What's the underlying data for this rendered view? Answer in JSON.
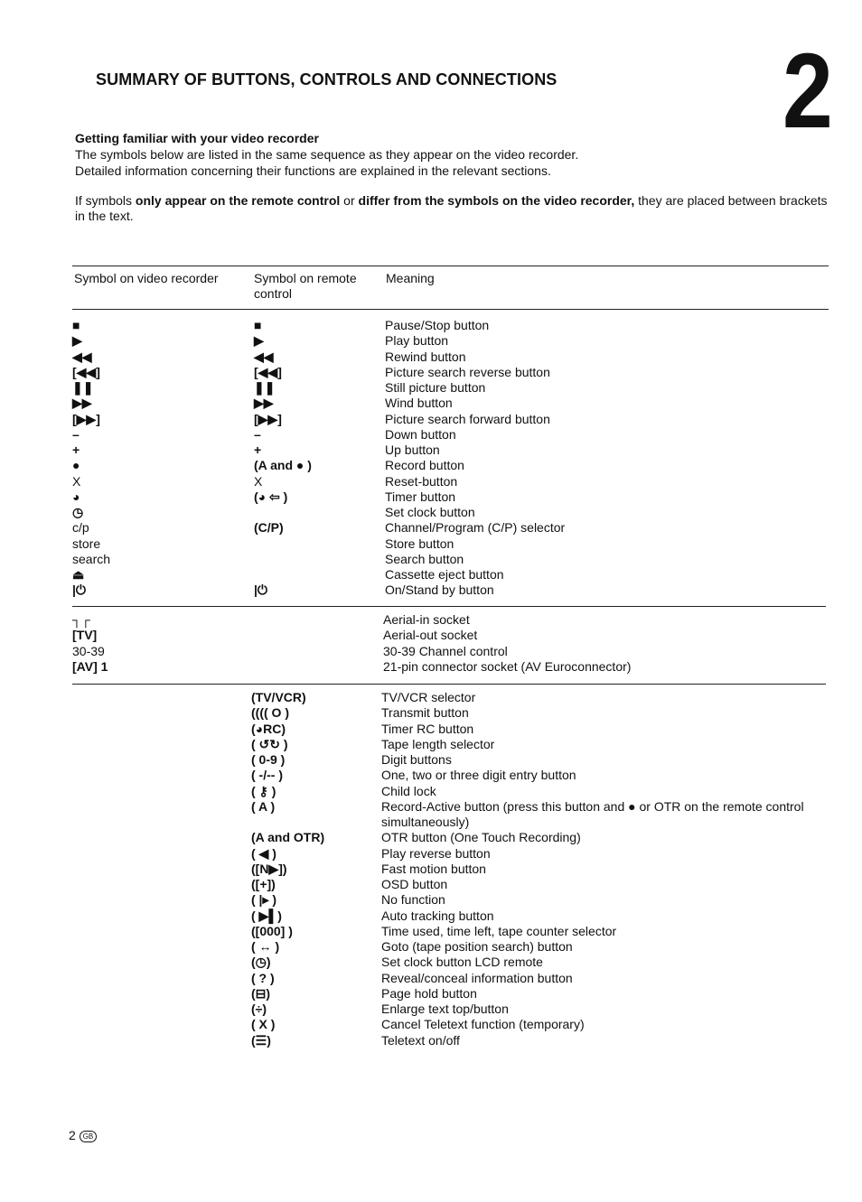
{
  "page": {
    "title": "SUMMARY OF BUTTONS, CONTROLS AND CONNECTIONS",
    "chapter_number": "2",
    "subheading": "Getting familiar with your video recorder",
    "intro_line1": "The symbols below are listed in the same sequence as they appear on the video recorder.",
    "intro_line2": "Detailed information concerning their functions are explained in the relevant sections.",
    "note_part1": "If symbols ",
    "note_bold1": "only appear on the remote control",
    "note_part2": " or ",
    "note_bold2": "differ from the symbols on the video recorder,",
    "note_part3": " they are placed between brackets in the text.",
    "footer_page": "2",
    "footer_region": "GB"
  },
  "table": {
    "headers": [
      "Symbol on video recorder",
      "Symbol on remote control",
      "Meaning"
    ],
    "section1": [
      [
        "■",
        "■",
        "Pause/Stop button"
      ],
      [
        "▶",
        "▶",
        "Play button"
      ],
      [
        "◀◀",
        "◀◀",
        "Rewind button"
      ],
      [
        "[◀◀]",
        "[◀◀]",
        "Picture search reverse button"
      ],
      [
        "❚❚",
        "❚❚",
        "Still picture button"
      ],
      [
        "▶▶",
        "▶▶",
        "Wind button"
      ],
      [
        "[▶▶]",
        "[▶▶]",
        "Picture search forward button"
      ],
      [
        "–",
        "–",
        "Down button"
      ],
      [
        "+",
        "+",
        "Up button"
      ],
      [
        "●",
        "(A and ● )",
        "Record button"
      ],
      [
        "X",
        "X",
        "Reset-button"
      ],
      [
        "◕",
        "(◕ ⇦ )",
        "Timer button"
      ],
      [
        "◷",
        "",
        "Set clock button"
      ],
      [
        "c/p",
        "(C/P)",
        "Channel/Program (C/P) selector"
      ],
      [
        "store",
        "",
        "Store button"
      ],
      [
        "search",
        "",
        "Search button"
      ],
      [
        "⏏",
        "",
        "Cassette eject button"
      ],
      [
        "|⏻",
        "|⏻",
        "On/Stand  by button"
      ]
    ],
    "section2": [
      [
        "┐┌",
        "",
        "Aerial-in socket"
      ],
      [
        "[TV]",
        "",
        "Aerial-out socket"
      ],
      [
        "30-39",
        "",
        "30-39 Channel control"
      ],
      [
        "[AV] 1",
        "",
        "21-pin connector socket (AV Euroconnector)"
      ]
    ],
    "section3": [
      [
        "",
        "(TV/VCR)",
        "TV/VCR selector"
      ],
      [
        "",
        "(((( O )",
        "Transmit button"
      ],
      [
        "",
        "(◕RC)",
        "Timer RC button"
      ],
      [
        "",
        "( ↺↻ )",
        "Tape length selector"
      ],
      [
        "",
        "( 0-9 )",
        "Digit buttons"
      ],
      [
        "",
        "( -/-- )",
        "One, two or three digit entry button"
      ],
      [
        "",
        "( ⚷ )",
        "Child lock"
      ],
      [
        "",
        "( A )",
        "Record-Active button (press this button and ● or OTR on the remote control"
      ],
      [
        "",
        "",
        "simultaneously)"
      ],
      [
        "",
        "(A and OTR)",
        "OTR button (One Touch Recording)"
      ],
      [
        "",
        "( ◀ )",
        "Play reverse button"
      ],
      [
        "",
        "([N▶])",
        "Fast motion button"
      ],
      [
        "",
        "([+])",
        "OSD button"
      ],
      [
        "",
        "( |▸ )",
        "No function"
      ],
      [
        "",
        "( ▶▌)",
        "Auto tracking button"
      ],
      [
        "",
        "([000] )",
        "Time used, time left, tape counter selector"
      ],
      [
        "",
        "( ↔ )",
        "Goto (tape position search) button"
      ],
      [
        "",
        "(◷)",
        "Set clock button LCD remote"
      ],
      [
        "",
        "( ? )",
        "Reveal/conceal information button"
      ],
      [
        "",
        "(⊟)",
        "Page hold button"
      ],
      [
        "",
        "(÷)",
        "Enlarge text top/button"
      ],
      [
        "",
        "( X )",
        "Cancel Teletext function (temporary)"
      ],
      [
        "",
        "(☰)",
        "Teletext on/off"
      ]
    ]
  }
}
